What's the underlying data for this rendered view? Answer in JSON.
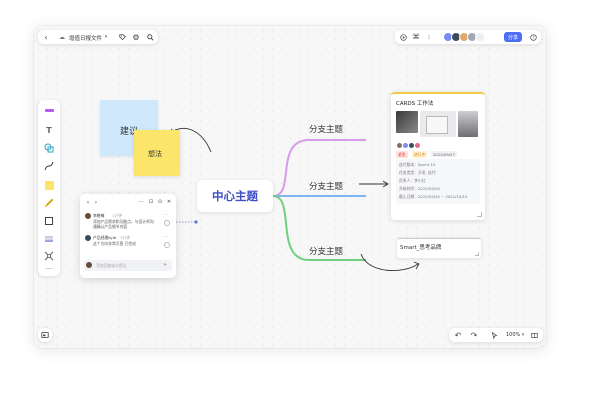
{
  "header": {
    "doc_title": "增值日报文件",
    "share_label": "分享"
  },
  "stickies": {
    "blue": "建议",
    "yellow": "想法"
  },
  "comment_panel": {
    "entries": [
      {
        "author": "李晓梅",
        "time": "1分钟",
        "text": "添加产品需求和功能点，与设计师沟通确认产品细节内容"
      },
      {
        "author": "产品经理Kyle",
        "time": "3分钟",
        "text": "这个方向非常可靠 已完成"
      }
    ],
    "input_placeholder": "添加回复或@提及"
  },
  "mindmap": {
    "center": "中心主题",
    "branches": [
      "分支主题",
      "分支主题",
      "分支主题"
    ]
  },
  "card": {
    "title": "CARDS 工作法",
    "tags": [
      "紧急",
      "进行中",
      "2022/09/27"
    ],
    "fields": [
      "迭代版本：Sprint 10",
      "任务类型：开发, 迭代",
      "负责人：李小红",
      "开始时间：2022/09/20",
      "截止日期：2022/09/30 ~ 2022/10/10"
    ]
  },
  "smart_box": {
    "title": "Smart_思考品牌"
  },
  "zoom": {
    "value": "100%"
  },
  "colors": {
    "accent": "#4f6ef7",
    "branch_pink": "#d89be8",
    "branch_blue": "#7fb4f2",
    "branch_green": "#6fd17f",
    "sticky_blue": "#cfe8fb",
    "sticky_yellow": "#fbe56a"
  },
  "icons": {
    "back": "chevron-left-icon",
    "cloud": "cloud-icon",
    "tag": "tag-icon",
    "settings": "gear-icon",
    "search": "search-icon",
    "present": "play-icon",
    "link": "link-icon",
    "more": "more-icon",
    "help": "help-icon",
    "undo": "undo-icon",
    "redo": "redo-icon",
    "pointer": "cursor-icon",
    "minimap": "minimap-icon"
  }
}
